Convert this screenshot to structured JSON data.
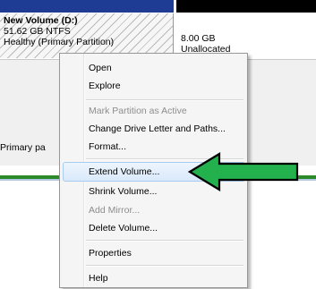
{
  "disk": {
    "partition": {
      "name": "New Volume  (D:)",
      "size": "51.62 GB NTFS",
      "status": "Healthy (Primary Partition)"
    },
    "unallocated": {
      "size": "8.00 GB",
      "label": "Unallocated"
    },
    "legend_text": "Primary pa"
  },
  "context_menu": {
    "items": [
      {
        "label": "Open",
        "enabled": true
      },
      {
        "label": "Explore",
        "enabled": true
      },
      {
        "label": "Mark Partition as Active",
        "enabled": false
      },
      {
        "label": "Change Drive Letter and Paths...",
        "enabled": true
      },
      {
        "label": "Format...",
        "enabled": true
      },
      {
        "label": "Extend Volume...",
        "enabled": true,
        "highlighted": true
      },
      {
        "label": "Shrink Volume...",
        "enabled": true
      },
      {
        "label": "Add Mirror...",
        "enabled": false
      },
      {
        "label": "Delete Volume...",
        "enabled": true
      },
      {
        "label": "Properties",
        "enabled": true
      },
      {
        "label": "Help",
        "enabled": true
      }
    ]
  },
  "colors": {
    "partition_bar": "#1f3c95",
    "unallocated_bar": "#000000",
    "arrow_fill": "#22b14c",
    "arrow_stroke": "#000000"
  },
  "annotation": {
    "arrow_icon": "left-arrow-icon"
  }
}
